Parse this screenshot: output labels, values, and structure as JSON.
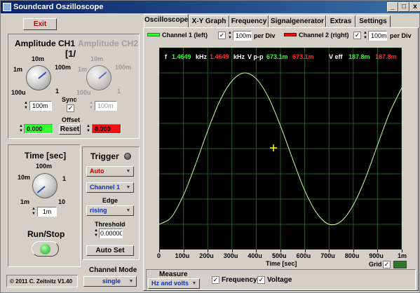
{
  "window": {
    "title": "Soundcard Oszilloscope",
    "min_label": "_",
    "max_label": "□",
    "close_label": "x"
  },
  "left": {
    "exit_label": "Exit",
    "amp_ch1_title": "Amplitude CH1",
    "amp_ch2_title": "Amplitude CH2",
    "bracket_text": "[1/",
    "knob_labels": {
      "k10m": "10m",
      "k1m": "1m",
      "k100m": "100m",
      "k100u": "100u",
      "k1": "1"
    },
    "sync_label": "Sync",
    "ch1_value": "100m",
    "ch2_value": "100m",
    "offset_label": "Offset",
    "offset_ch1": "0.000",
    "offset_ch2": "0.000",
    "reset_label": "Reset",
    "time_title": "Time [sec]",
    "time_knob_labels": {
      "t100m": "100m",
      "t10m": "10m",
      "t1": "1",
      "t1m": "1m",
      "t10": "10"
    },
    "time_value": "1m",
    "runstop_label": "Run/Stop",
    "copyright": "© 2011  C. Zeitnitz V1.40",
    "trigger_title": "Trigger",
    "trigger_mode": "Auto",
    "trigger_channel": "Channel 1",
    "edge_label": "Edge",
    "edge_value": "rising",
    "threshold_label": "Threshold",
    "threshold_value": "0.000000",
    "autoset_label": "Auto Set",
    "channel_mode_label": "Channel Mode",
    "channel_mode_value": "single"
  },
  "tabs": [
    "Oscilloscope",
    "X-Y Graph",
    "Frequency",
    "Signalgenerator",
    "Extras",
    "Settings"
  ],
  "scope": {
    "ch1_label": "Channel 1 (left)",
    "ch2_label": "Channel 2 (right)",
    "ch1_perdiv": "100m",
    "ch2_perdiv": "100m",
    "perdiv_label": "per Div",
    "f_label": "f",
    "f_ch1": "1.4649",
    "f_ch2": "1.4649",
    "f_unit": "kHz",
    "vpp_label": "V p-p",
    "vpp_ch1": "673.1m",
    "vpp_ch2": "673.1m",
    "veff_label": "V eff",
    "veff_ch1": "187.8m",
    "veff_ch2": "187.8m",
    "xticks": [
      "0",
      "100u",
      "200u",
      "300u",
      "400u",
      "500u",
      "600u",
      "700u",
      "800u",
      "900u",
      "1m"
    ],
    "xlabel": "Time [sec]",
    "grid_label": "Grid",
    "measure_label": "Measure",
    "measure_value": "Hz and volts",
    "freq_check_label": "Frequency",
    "volt_check_label": "Voltage"
  },
  "colors": {
    "ch1": "#00ff00",
    "ch2": "#ff2020",
    "trace": "#c8ff9a",
    "grid": "#2a5a2a",
    "panel": "#d4d0c8"
  },
  "chart_data": {
    "type": "line",
    "x_unit": "sec",
    "x": [
      0,
      5e-05,
      0.0001,
      0.00015,
      0.0002,
      0.00025,
      0.0003,
      0.00035,
      0.0004,
      0.00045,
      0.0005,
      0.00055,
      0.0006,
      0.00065,
      0.0007,
      0.00075,
      0.0008,
      0.00085,
      0.0009,
      0.00095,
      0.001
    ],
    "series": [
      {
        "name": "Channel 1 (left)",
        "values": [
          -0.3,
          -0.272,
          -0.185,
          -0.063,
          0.071,
          0.189,
          0.268,
          0.3,
          0.277,
          0.204,
          0.09,
          -0.041,
          -0.166,
          -0.256,
          -0.3,
          -0.288,
          -0.224,
          -0.118,
          0.014,
          0.142,
          0.241
        ]
      }
    ],
    "xlim": [
      0,
      0.001
    ],
    "ylim": [
      -0.4,
      0.4
    ],
    "xlabel": "Time [sec]",
    "grid": true
  }
}
